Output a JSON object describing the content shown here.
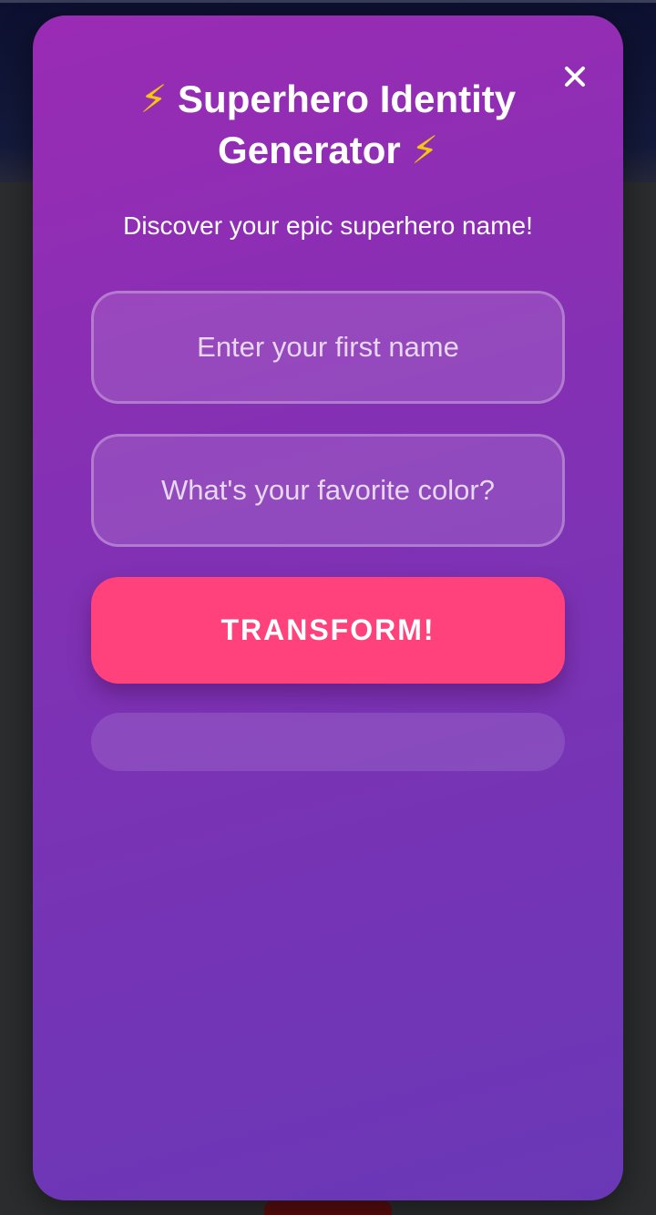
{
  "modal": {
    "title_line1": "Superhero Identity",
    "title_line2": "Generator",
    "title_icon": "lightning-bolt-icon",
    "subtitle": "Discover your epic superhero name!",
    "close_icon": "close-icon"
  },
  "form": {
    "name_placeholder": "Enter your first name",
    "name_value": "",
    "color_placeholder": "What's your favorite color?",
    "color_value": "",
    "submit_label": "TRANSFORM!",
    "result_text": ""
  },
  "colors": {
    "modal_gradient_start": "#9a2bb4",
    "modal_gradient_end": "#6a38b6",
    "button": "#ff417c",
    "bolt": "#f5c518",
    "backdrop": "#2c2d2e",
    "header_backdrop": "#0d1030"
  }
}
